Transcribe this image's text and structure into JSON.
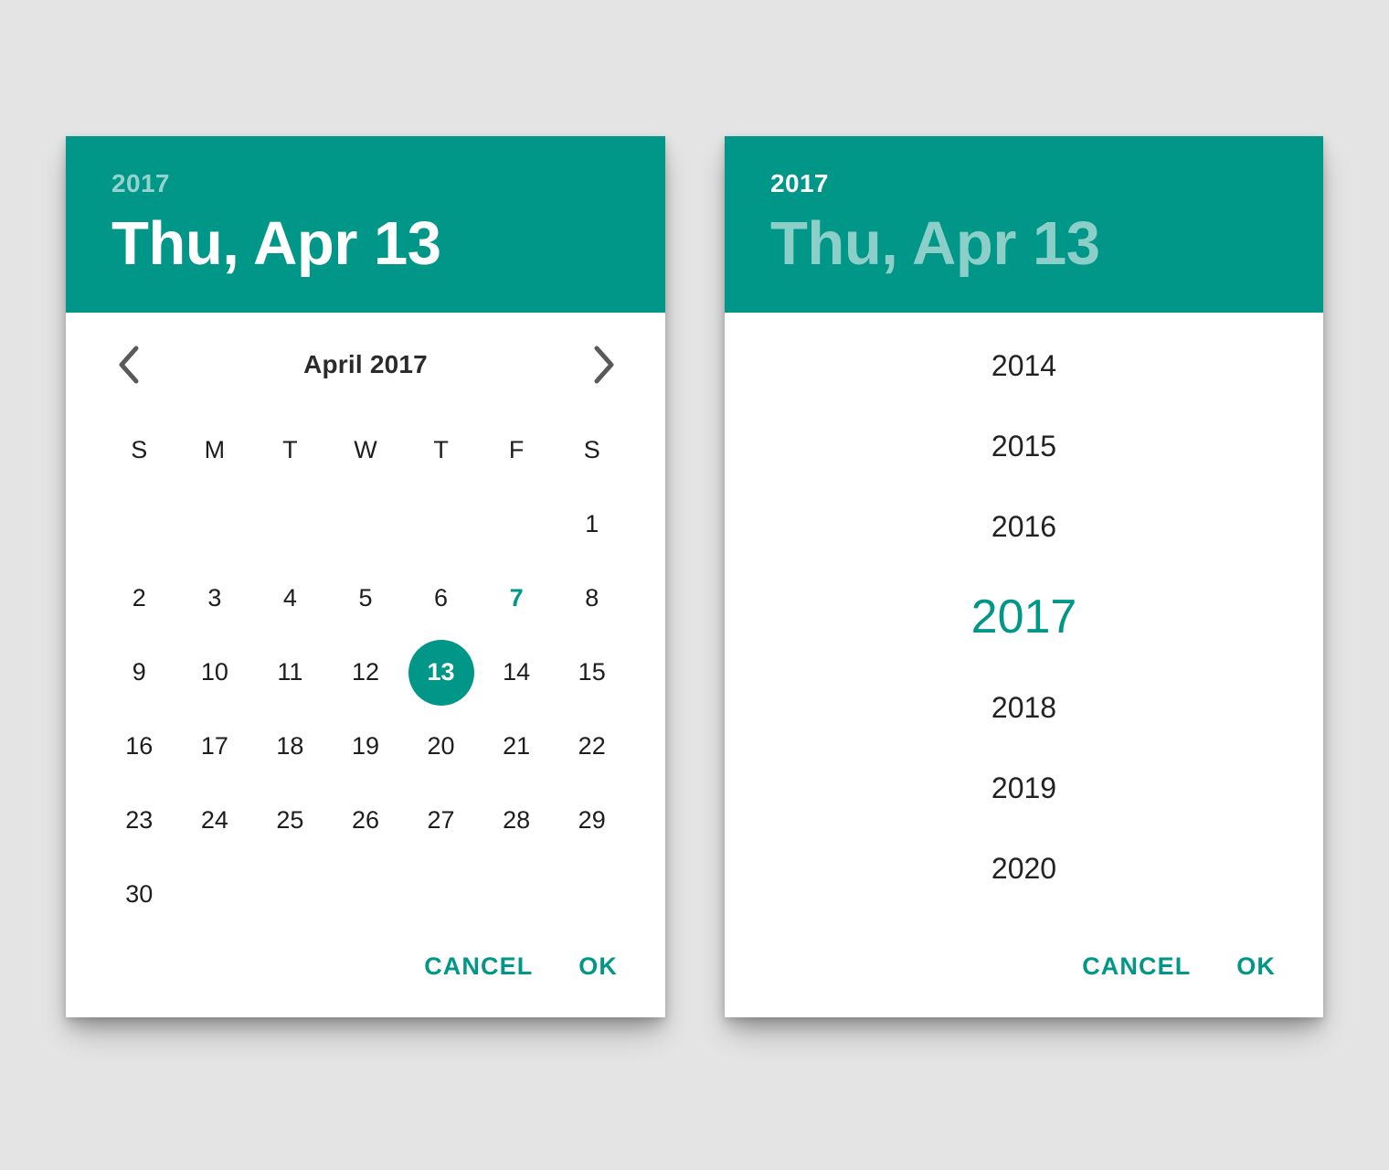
{
  "theme": {
    "accent": "#009688",
    "background": "#e4e4e4",
    "surface": "#ffffff",
    "text_primary": "#1d1d1d",
    "text_muted": "#a8a8a8"
  },
  "date_picker": {
    "header": {
      "year": "2017",
      "date": "Thu, Apr 13",
      "active": "date"
    },
    "month_nav": {
      "prev_icon": "chevron-left-icon",
      "next_icon": "chevron-right-icon",
      "label": "April 2017"
    },
    "weekdays": [
      "S",
      "M",
      "T",
      "W",
      "T",
      "F",
      "S"
    ],
    "weeks": [
      [
        "",
        "",
        "",
        "",
        "",
        "",
        "1"
      ],
      [
        "2",
        "3",
        "4",
        "5",
        "6",
        "7",
        "8"
      ],
      [
        "9",
        "10",
        "11",
        "12",
        "13",
        "14",
        "15"
      ],
      [
        "16",
        "17",
        "18",
        "19",
        "20",
        "21",
        "22"
      ],
      [
        "23",
        "24",
        "25",
        "26",
        "27",
        "28",
        "29"
      ],
      [
        "30",
        "",
        "",
        "",
        "",
        "",
        ""
      ]
    ],
    "selected_day": "13",
    "today_day": "7",
    "actions": {
      "cancel": "CANCEL",
      "ok": "OK"
    }
  },
  "year_picker": {
    "header": {
      "year": "2017",
      "date": "Thu, Apr 13",
      "active": "year"
    },
    "years": [
      "2014",
      "2015",
      "2016",
      "2017",
      "2018",
      "2019",
      "2020"
    ],
    "selected_year": "2017",
    "actions": {
      "cancel": "CANCEL",
      "ok": "OK"
    }
  }
}
